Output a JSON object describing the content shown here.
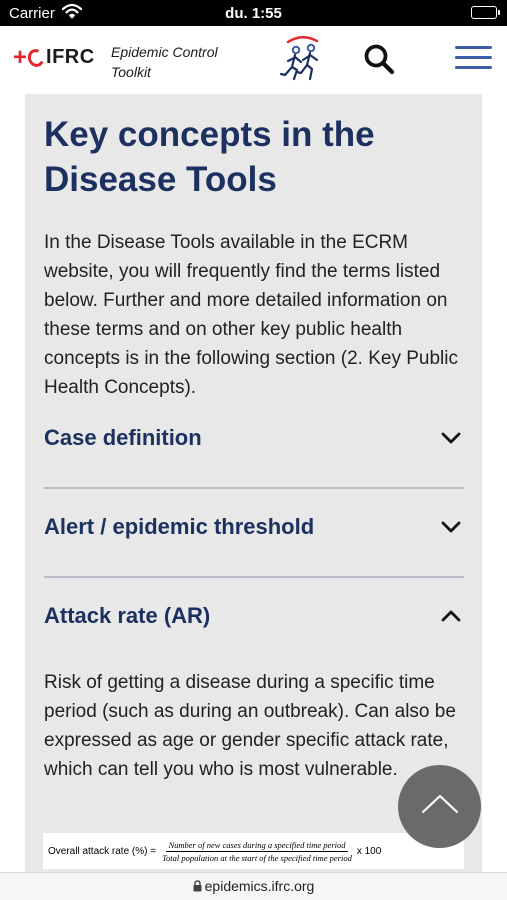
{
  "status_bar": {
    "carrier": "Carrier",
    "time": "du. 1:55"
  },
  "header": {
    "logo_text": "IFRC",
    "logo_cross": "+",
    "toolkit_name_line1": "Epidemic Control",
    "toolkit_name_line2": "Toolkit",
    "brand_red": "#e5242b",
    "brand_blue": "#3d5ca8"
  },
  "main": {
    "title_line1": "Key concepts in the",
    "title_line2": "Disease Tools",
    "intro": "In the Disease Tools available in the ECRM website, you will frequently find the terms listed below. Further and more detailed information on these terms and on other key public health concepts is in the following section (2. Key Public Health Concepts).",
    "accordion": [
      {
        "title": "Case definition",
        "expanded": false
      },
      {
        "title": "Alert / epidemic threshold",
        "expanded": false
      },
      {
        "title": "Attack rate (AR)",
        "expanded": true
      }
    ],
    "attack_rate_text": "Risk of getting a disease during a specific time period (such as during an outbreak). Can also be expressed as age or gender specific attack rate, which can tell you who is most vulnerable.",
    "formula": {
      "lhs": "Overall attack rate (%) =",
      "numerator": "Number of new cases during a specified time period",
      "denominator": "Total population at the start of the specified time period",
      "multiplier": "x 100"
    },
    "title_color": "#1d3161"
  },
  "url_bar": {
    "url": "epidemics.ifrc.org"
  }
}
